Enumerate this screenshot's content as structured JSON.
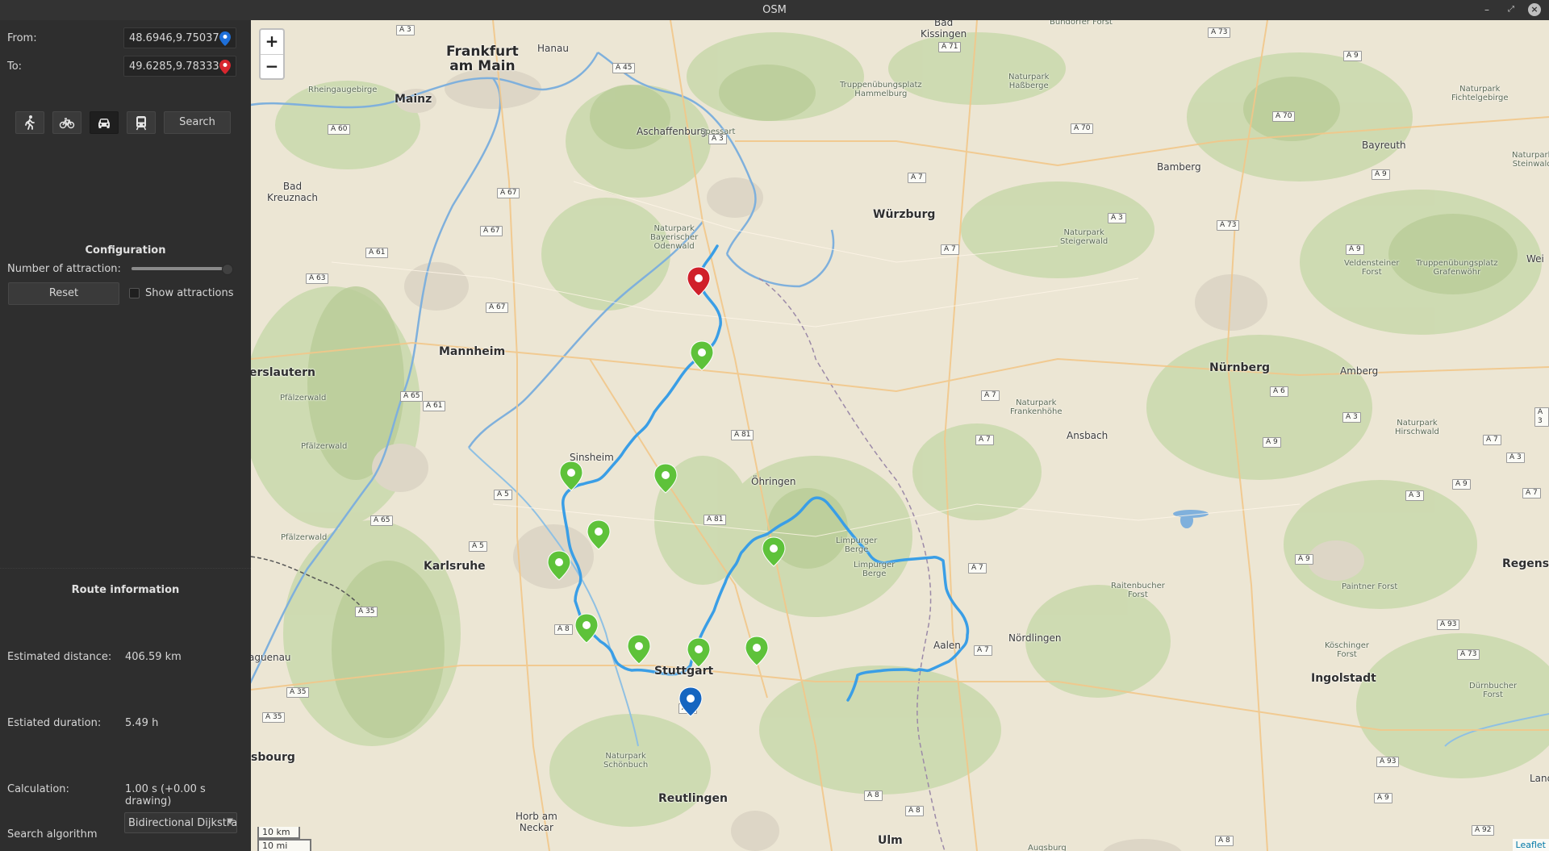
{
  "window": {
    "title": "OSM"
  },
  "controls": {
    "from_label": "From:",
    "from_value": "48.6946,9.75037",
    "to_label": "To:",
    "to_value": "49.6285,9.78333",
    "search_label": "Search",
    "modes": [
      "walk-icon",
      "bike-icon",
      "car-icon",
      "transit-icon"
    ],
    "active_mode": "car-icon"
  },
  "configuration": {
    "title": "Configuration",
    "attractions_label": "Number of attraction:",
    "attractions_level": 1.0,
    "reset_label": "Reset",
    "show_attractions_label": "Show attractions",
    "show_attractions_checked": false
  },
  "route_info": {
    "title": "Route information",
    "distance_label": "Estimated distance:",
    "distance_value": "406.59 km",
    "duration_label": "Estiated duration:",
    "duration_value": "5.49 h",
    "calc_label": "Calculation:",
    "calc_value": "1.00 s (+0.00 s drawing)",
    "algo_label": "Search algorithm",
    "algo_value": "Bidirectional Dijkstra"
  },
  "map": {
    "zoom_in": "+",
    "zoom_out": "−",
    "scale_km": "10 km",
    "scale_mi": "10 mi",
    "attribution": "Leaflet",
    "colors": {
      "route": "#3a9ee6",
      "start_pin": "#1565c0",
      "end_pin": "#d0202a",
      "attraction_pin": "#5ec23a"
    },
    "places": {
      "frankfurt": "Frankfurt\nam Main",
      "mainz": "Mainz",
      "hanau": "Hanau",
      "aschaffenburg": "Aschaffenburg",
      "wuerzburg": "Würzburg",
      "bad_kissingen": "Bad\nKissingen",
      "bad_kreuznach": "Bad\nKreuznach",
      "mannheim": "Mannheim",
      "kaiserslautern": "erslautern",
      "sinsheim": "Sinsheim",
      "oehringen": "Öhringen",
      "karlsruhe": "Karlsruhe",
      "stuttgart": "Stuttgart",
      "reutlingen": "Reutlingen",
      "horb": "Horb am\nNeckar",
      "ulm": "Ulm",
      "aalen": "Aalen",
      "noerdlingen": "Nördlingen",
      "ansbach": "Ansbach",
      "nuernberg": "Nürnberg",
      "amberg": "Amberg",
      "bamberg": "Bamberg",
      "bayreuth": "Bayreuth",
      "ingolstadt": "Ingolstadt",
      "regensburg": "Regensb",
      "haguenau": "aguenau",
      "strasbourg": "sbourg",
      "wei": "Wei",
      "lan": "Land",
      "steinwald": "Naturpark\nSteinwald",
      "rheingau": "Rheingaugebirge",
      "spessart": "Spessart",
      "hassberge": "Naturpark\nHaßberge",
      "truppen_hammelburg": "Truppenübungsplatz\nHammelburg",
      "bundorfer": "Bundorfer Forst",
      "odenwald": "Naturpark\nBayerischer\nOdenwald",
      "steigerwald": "Naturpark\nSteigerwald",
      "fichtelgebirge": "Naturpark\nFichtelgebirge",
      "veldensteiner": "Veldensteiner\nForst",
      "grafenwoehr": "Truppenübungsplatz\nGrafenwöhr",
      "pfaelzerwald1": "Pfälzerwald",
      "pfaelzerwald2": "Pfälzerwald",
      "pfaelzerwald3": "Pfälzerwald",
      "frankenhoehe": "Naturpark\nFrankenhöhe",
      "hirschwald": "Naturpark\nHirschwald",
      "limpurger1": "Limpurger\nBerge",
      "limpurger2": "Limpurger\nBerge",
      "raitenbucher": "Raitenbucher\nForst",
      "paintner": "Paintner Forst",
      "koschinger": "Köschinger\nForst",
      "duernbucher": "Dürnbucher\nForst",
      "schoenbuch": "Naturpark\nSchönbuch",
      "augsburg_frag": "Augsburg"
    },
    "roads": {
      "r1": "A 3",
      "r2": "A 45",
      "r3": "A 60",
      "r4": "A 3",
      "r5": "A 67",
      "r6": "A 67",
      "r7": "A 61",
      "r8": "A 63",
      "r9": "A 67",
      "r10": "A 65",
      "r11": "A 61",
      "r12": "A 81",
      "r13": "A 5",
      "r14": "A 65",
      "r15": "A 5",
      "r16": "A 81",
      "r17": "A 35",
      "r18": "A 35",
      "r19": "A 35",
      "r20": "A 8",
      "r21": "A 8",
      "r22": "A 8",
      "r23": "A 8",
      "r24": "A 7",
      "r25": "A 7",
      "r26": "A 7",
      "r27": "A 7",
      "r28": "A 7",
      "r29": "A 7",
      "r30": "A 3",
      "r31": "A 70",
      "r32": "A 73",
      "r33": "A 73",
      "r34": "A 70",
      "r35": "A 9",
      "r36": "A 9",
      "r37": "A 9",
      "r38": "A 6",
      "r39": "A 3",
      "r40": "A 9",
      "r41": "A 9",
      "r42": "A 3",
      "r43": "A 93",
      "r44": "A 93",
      "r45": "A 9",
      "r46": "A 92",
      "r47": "A 8",
      "r48": "A 71",
      "r49": "A 7",
      "r50": "A 73",
      "r51": "A 9",
      "r52": "A 3",
      "r53": "A 7",
      "r54": "A 3"
    }
  }
}
